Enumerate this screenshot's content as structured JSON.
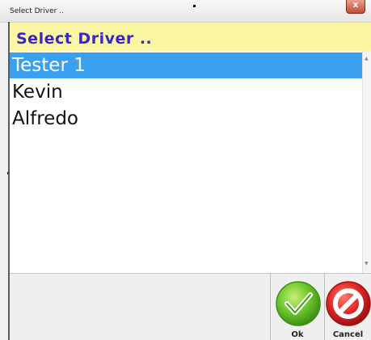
{
  "window": {
    "title": "Select Driver ..",
    "close_label": "x"
  },
  "header": {
    "title": "Select Driver .."
  },
  "drivers": [
    {
      "name": "Tester 1",
      "selected": true
    },
    {
      "name": "Kevin",
      "selected": false
    },
    {
      "name": "Alfredo",
      "selected": false
    }
  ],
  "buttons": {
    "ok": "Ok",
    "cancel": "Cancel"
  },
  "colors": {
    "header_bg": "#faf6a3",
    "header_text": "#3a26c8",
    "selection": "#3aa0f0",
    "ok_icon": "#5fbf2a",
    "cancel_icon": "#d92424"
  },
  "icons": {
    "ok": "check-icon",
    "cancel": "cancel-icon"
  }
}
